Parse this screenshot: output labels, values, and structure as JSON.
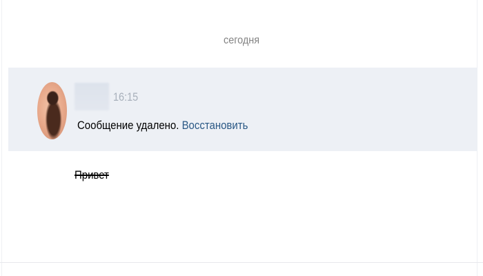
{
  "date_separator": "сегодня",
  "message": {
    "time": "16:15",
    "deleted_text": "Сообщение удалено.",
    "restore_label": "Восстановить"
  },
  "next_message": {
    "text": "Привет"
  },
  "colors": {
    "highlight_bg": "#edf0f5",
    "link": "#2a5885",
    "muted": "#828282"
  },
  "icons": {
    "avatar": "user-avatar-photo"
  }
}
